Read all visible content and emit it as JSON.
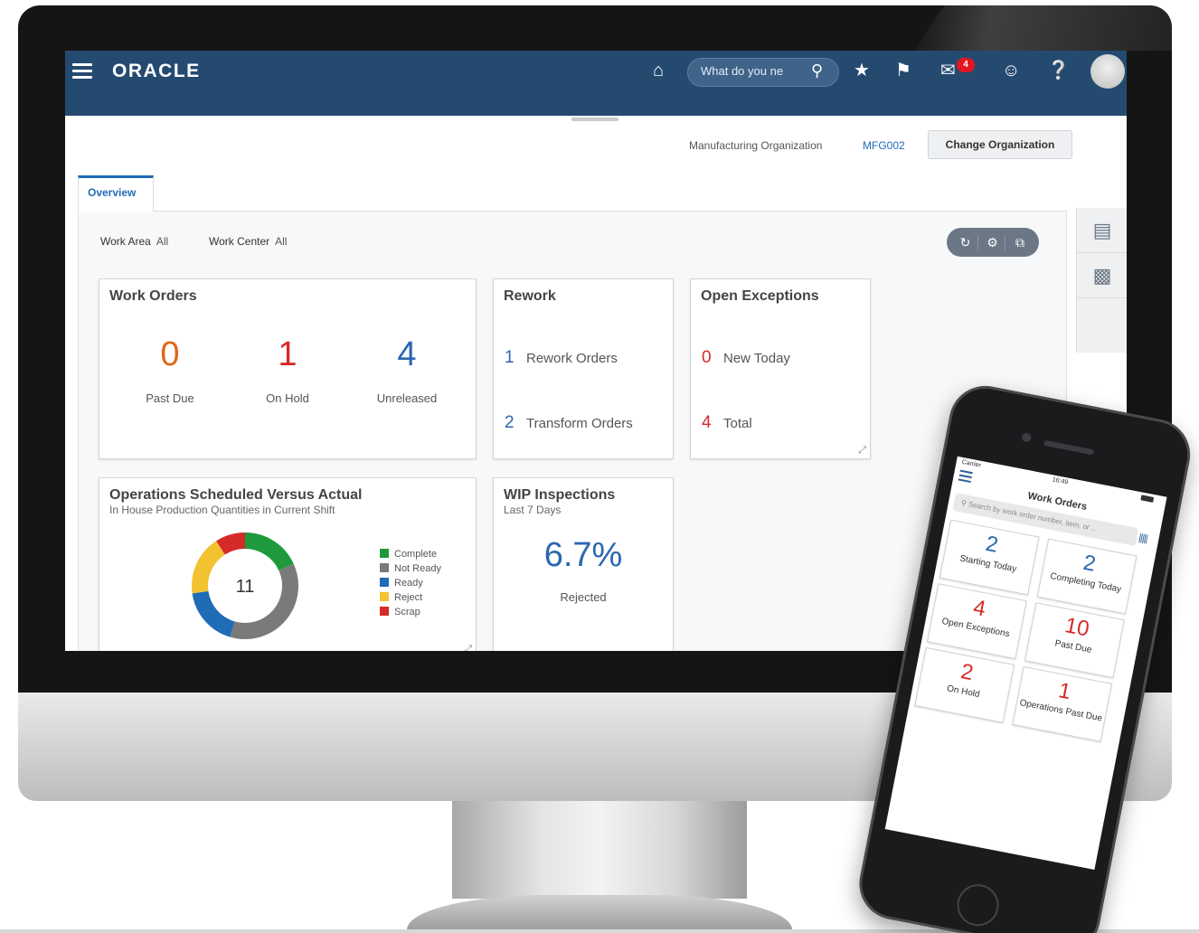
{
  "header": {
    "logo": "ORACLE",
    "search_placeholder": "What do you ne",
    "notification_count": "4"
  },
  "org_bar": {
    "label": "Manufacturing Organization",
    "value": "MFG002",
    "change_button": "Change Organization"
  },
  "tabs": [
    {
      "label": "Overview"
    }
  ],
  "filters": {
    "work_area_label": "Work Area",
    "work_area_value": "All",
    "work_center_label": "Work Center",
    "work_center_value": "All"
  },
  "work_orders": {
    "title": "Work Orders",
    "metrics": [
      {
        "value": "0",
        "label": "Past Due",
        "color": "#e0661a"
      },
      {
        "value": "1",
        "label": "On Hold",
        "color": "#d62a2a"
      },
      {
        "value": "4",
        "label": "Unreleased",
        "color": "#2a67b0"
      }
    ]
  },
  "rework": {
    "title": "Rework",
    "rows": [
      {
        "value": "1",
        "label": "Rework Orders",
        "color": "#2a67b0"
      },
      {
        "value": "2",
        "label": "Transform Orders",
        "color": "#2a67b0"
      }
    ]
  },
  "exceptions": {
    "title": "Open Exceptions",
    "rows": [
      {
        "value": "0",
        "label": "New Today",
        "color": "#d62a2a"
      },
      {
        "value": "4",
        "label": "Total",
        "color": "#d62a2a"
      }
    ]
  },
  "operations": {
    "title": "Operations Scheduled Versus Actual",
    "subtitle": "In House Production Quantities in Current Shift",
    "center_value": "11"
  },
  "chart_data": {
    "type": "pie",
    "title": "Operations Scheduled Versus Actual",
    "subtitle": "In House Production Quantities in Current Shift",
    "center_label": "11",
    "legend_position": "right",
    "series": [
      {
        "name": "Complete",
        "value": 2,
        "color": "#1e9a3c"
      },
      {
        "name": "Not Ready",
        "value": 4,
        "color": "#7a7a7a"
      },
      {
        "name": "Ready",
        "value": 2,
        "color": "#1f6bb5"
      },
      {
        "name": "Reject",
        "value": 2,
        "color": "#f2c230"
      },
      {
        "name": "Scrap",
        "value": 1,
        "color": "#d62a2a"
      }
    ]
  },
  "wip": {
    "title": "WIP Inspections",
    "subtitle": "Last 7 Days",
    "value": "6.7%",
    "label": "Rejected"
  },
  "mobile": {
    "carrier": "Carrier",
    "time": "16:49",
    "title": "Work Orders",
    "search_placeholder": "Search by work order number, item, or ...",
    "tiles": [
      {
        "value": "2",
        "label": "Starting Today",
        "color": "#2a67b0"
      },
      {
        "value": "2",
        "label": "Completing Today",
        "color": "#2a67b0"
      },
      {
        "value": "4",
        "label": "Open Exceptions",
        "color": "#d62a2a"
      },
      {
        "value": "10",
        "label": "Past Due",
        "color": "#d62a2a"
      },
      {
        "value": "2",
        "label": "On Hold",
        "color": "#d62a2a"
      },
      {
        "value": "1",
        "label": "Operations Past Due",
        "color": "#d62a2a"
      }
    ]
  }
}
